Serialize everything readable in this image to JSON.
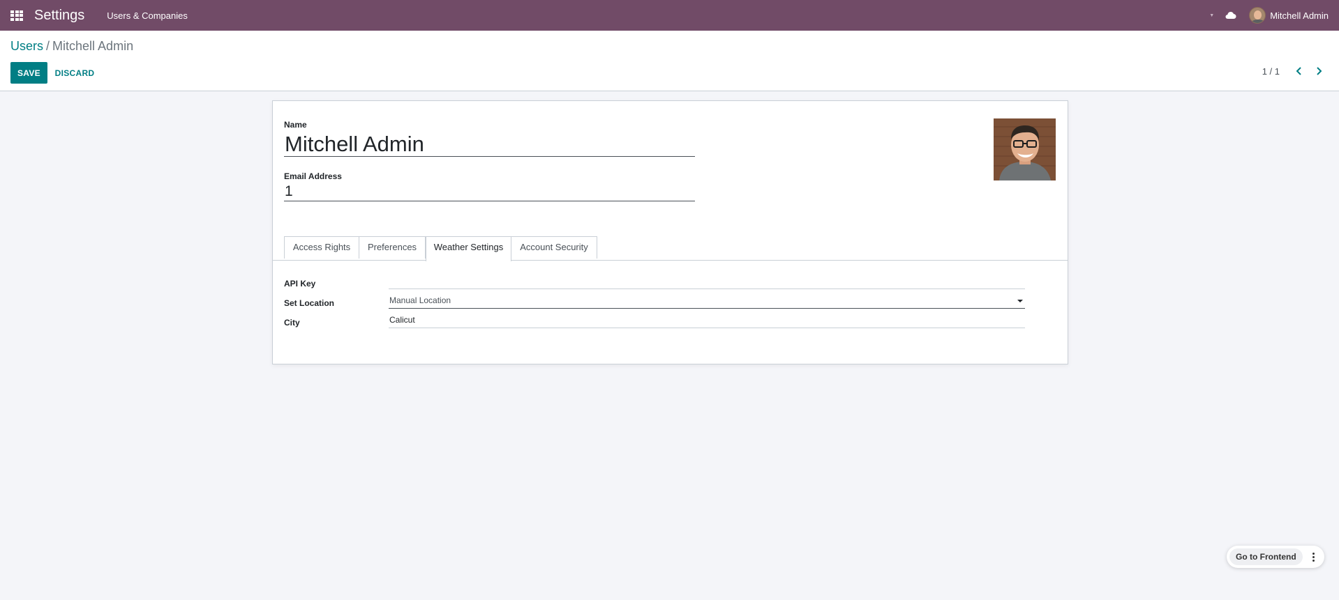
{
  "navbar": {
    "app_title": "Settings",
    "menu_item": "Users & Companies",
    "user_name": "Mitchell Admin",
    "color": "#714b67"
  },
  "breadcrumb": {
    "parent": "Users",
    "separator": "/",
    "current": "Mitchell Admin"
  },
  "toolbar": {
    "save_label": "SAVE",
    "discard_label": "DISCARD"
  },
  "pager": {
    "value": "1 / 1"
  },
  "form": {
    "name_label": "Name",
    "name_value": "Mitchell Admin",
    "email_label": "Email Address",
    "email_value": "1"
  },
  "tabs": [
    {
      "label": "Access Rights",
      "active": false
    },
    {
      "label": "Preferences",
      "active": false
    },
    {
      "label": "Weather Settings",
      "active": true
    },
    {
      "label": "Account Security",
      "active": false
    }
  ],
  "weather": {
    "api_key_label": "API Key",
    "api_key_value": "",
    "set_location_label": "Set Location",
    "set_location_value": "Manual Location",
    "city_label": "City",
    "city_value": "Calicut"
  },
  "frontend": {
    "label": "Go to Frontend"
  },
  "colors": {
    "accent": "#017e84",
    "background": "#f4f5f9"
  }
}
